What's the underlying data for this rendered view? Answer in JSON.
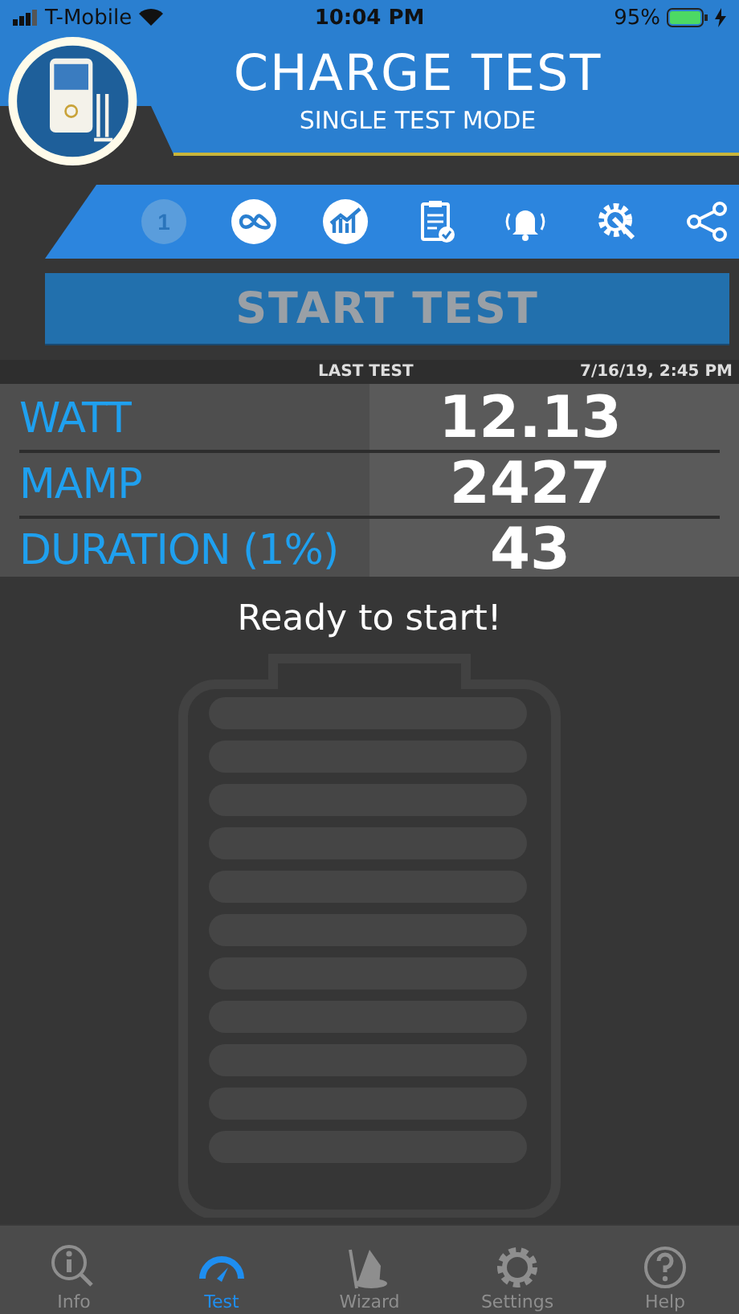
{
  "status_bar": {
    "carrier": "T-Mobile",
    "time": "10:04 PM",
    "battery": "95%"
  },
  "header": {
    "title": "CHARGE TEST",
    "subtitle": "SINGLE TEST MODE"
  },
  "toolbar": [
    {
      "kind": "single",
      "label": "1",
      "selected": true
    },
    {
      "kind": "loop",
      "selected": false
    },
    {
      "kind": "chart",
      "selected": false
    },
    {
      "kind": "report",
      "selected": false
    },
    {
      "kind": "alarm",
      "selected": false
    },
    {
      "kind": "tools",
      "selected": false
    },
    {
      "kind": "share",
      "selected": false
    }
  ],
  "start_button": {
    "label": "START TEST",
    "disabled": true
  },
  "last_test": {
    "label": "LAST TEST",
    "date": "7/16/19, 2:45 PM"
  },
  "metrics": [
    {
      "name": "WATT",
      "value": "12.13"
    },
    {
      "name": "MAMP",
      "value": "2427"
    },
    {
      "name": "DURATION (1%)",
      "value": "43"
    }
  ],
  "message": "Ready to start!",
  "tab_bar": [
    {
      "kind": "info",
      "label": "Info",
      "selected": false
    },
    {
      "kind": "test",
      "label": "Test",
      "selected": true
    },
    {
      "kind": "wizard",
      "label": "Wizard",
      "selected": false
    },
    {
      "kind": "settings",
      "label": "Settings",
      "selected": false
    },
    {
      "kind": "help",
      "label": "Help",
      "selected": false
    }
  ]
}
